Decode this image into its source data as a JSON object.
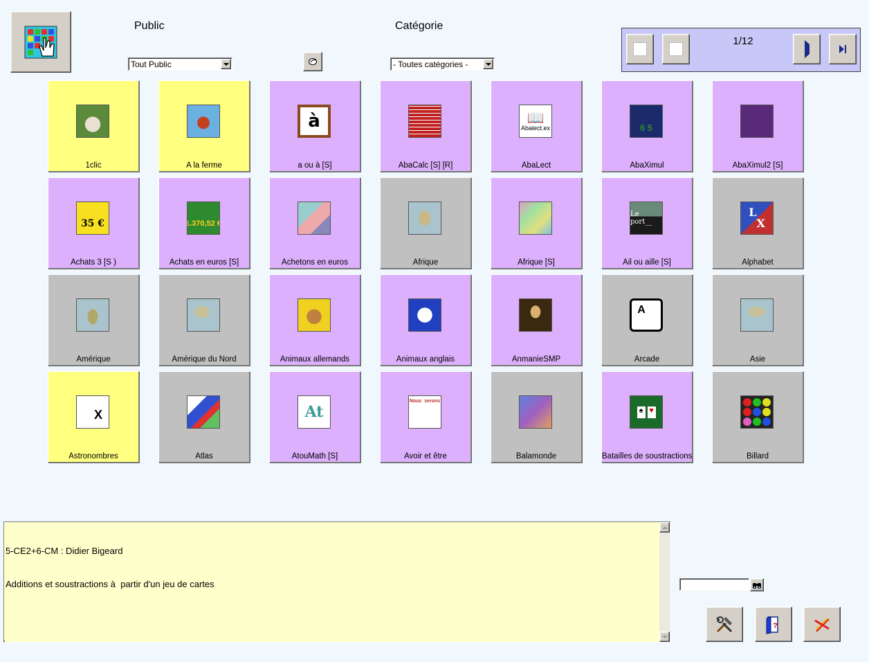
{
  "header": {
    "public_label": "Public",
    "category_label": "Catégorie",
    "public_select": "Tout Public",
    "category_select": "- Toutes catégories -"
  },
  "pagination": {
    "page": "1/12"
  },
  "tiles": [
    {
      "label": "1clic",
      "color": "yellow",
      "icon": "shoe-icon"
    },
    {
      "label": "A la ferme",
      "color": "yellow",
      "icon": "rooster-icon"
    },
    {
      "label": "a ou à  [S]",
      "color": "violet",
      "icon": "letter-a-grave-icon",
      "glyph": "à"
    },
    {
      "label": "AbaCalc [S] [R]",
      "color": "violet",
      "icon": "abacus-icon"
    },
    {
      "label": "AbaLect",
      "color": "violet",
      "icon": "open-book-icon",
      "glyph": "Abalect.ex"
    },
    {
      "label": "AbaXimul",
      "color": "violet",
      "icon": "number-board-icon",
      "glyph": "6 5"
    },
    {
      "label": "AbaXimul2 [S]",
      "color": "violet",
      "icon": "number-board-2-icon"
    },
    {
      "label": "Achats 3 [S )",
      "color": "violet",
      "icon": "price-tag-icon",
      "glyph": "35 €"
    },
    {
      "label": "Achats en euros [S]",
      "color": "violet",
      "icon": "euro-coins-icon",
      "glyph": "1.370,52 €"
    },
    {
      "label": "Achetons en euros",
      "color": "violet",
      "icon": "euro-notes-icon"
    },
    {
      "label": "Afrique",
      "color": "grey",
      "icon": "africa-map-icon"
    },
    {
      "label": "Afrique [S]",
      "color": "violet",
      "icon": "africa-political-map-icon"
    },
    {
      "label": "Ail ou aille [S]",
      "color": "violet",
      "icon": "harbor-photo-icon",
      "glyph": "Le port__"
    },
    {
      "label": "Alphabet",
      "color": "grey",
      "icon": "alphabet-blocks-icon"
    },
    {
      "label": "Amérique",
      "color": "grey",
      "icon": "south-america-map-icon"
    },
    {
      "label": "Amérique du Nord",
      "color": "grey",
      "icon": "north-america-map-icon"
    },
    {
      "label": "Animaux allemands",
      "color": "violet",
      "icon": "rabbit-icon"
    },
    {
      "label": "Animaux anglais",
      "color": "violet",
      "icon": "duck-icon"
    },
    {
      "label": "AnmanieSMP",
      "color": "violet",
      "icon": "mona-lisa-icon"
    },
    {
      "label": "Arcade",
      "color": "grey",
      "icon": "keyboard-key-icon",
      "glyph": "A"
    },
    {
      "label": "Asie",
      "color": "grey",
      "icon": "asia-map-icon"
    },
    {
      "label": "Astronombres",
      "color": "yellow",
      "icon": "math-grid-icon",
      "glyph": "X"
    },
    {
      "label": "Atlas",
      "color": "grey",
      "icon": "europe-map-icon"
    },
    {
      "label": "AtouMath [S]",
      "color": "violet",
      "icon": "math-letters-icon",
      "glyph": "At"
    },
    {
      "label": "Avoir et être",
      "color": "violet",
      "icon": "sentence-card-icon",
      "glyph": "Nous  serons"
    },
    {
      "label": "Balamonde",
      "color": "grey",
      "icon": "world-puzzle-icon"
    },
    {
      "label": "Batailles de soustractions",
      "color": "violet",
      "icon": "playing-cards-icon"
    },
    {
      "label": "Billard",
      "color": "grey",
      "icon": "colored-balls-icon"
    }
  ],
  "description": {
    "line1": "5-CE2+6-CM : Didier Bigeard",
    "line2": "Additions et soustractions à  partir d'un jeu de cartes"
  },
  "search": {
    "value": ""
  }
}
